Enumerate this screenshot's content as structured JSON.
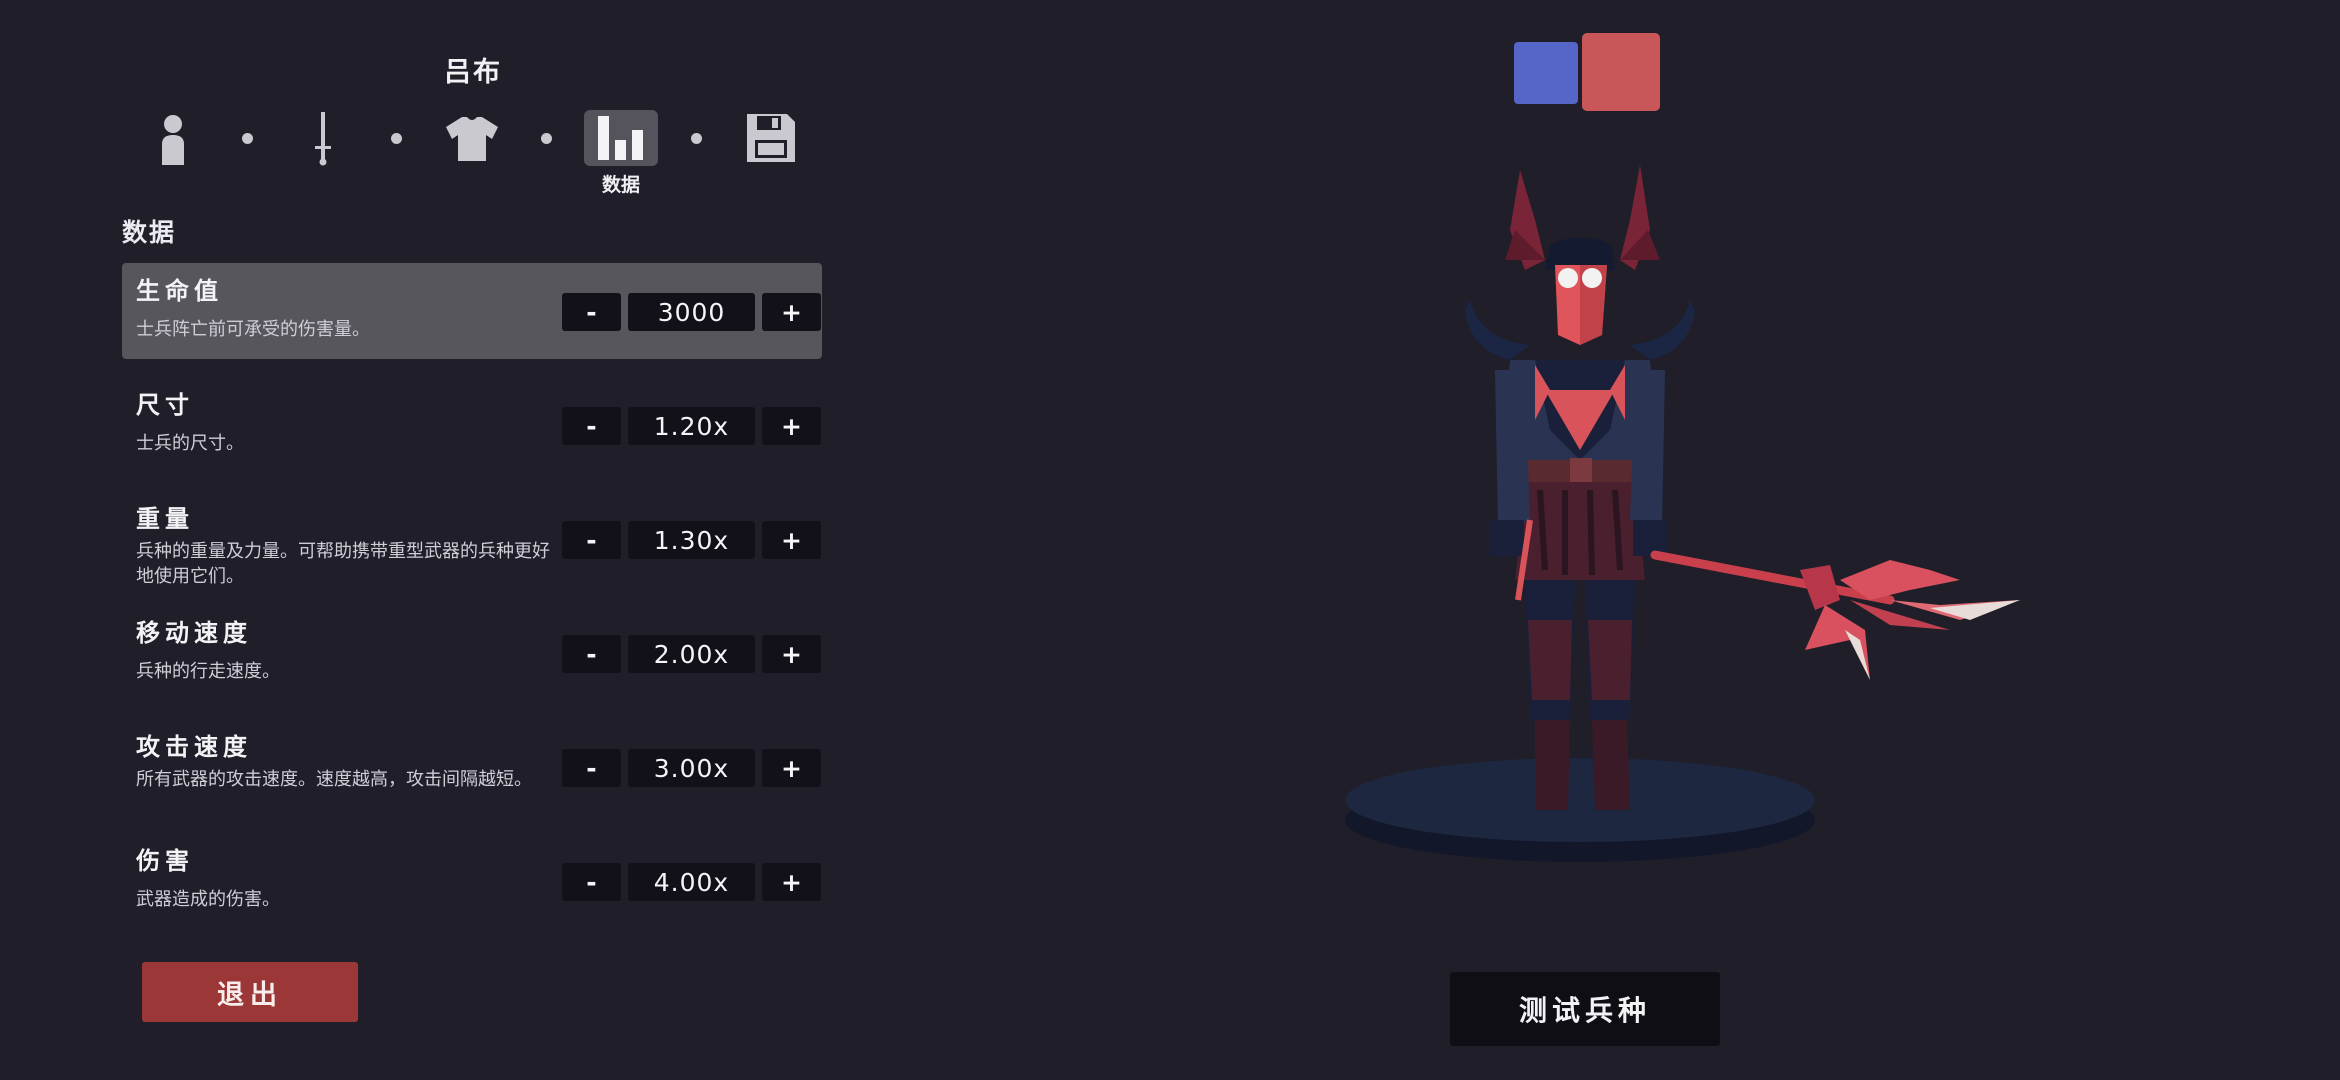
{
  "unit": {
    "name": "吕布"
  },
  "steps": [
    {
      "icon": "body-icon",
      "label": ""
    },
    {
      "icon": "sword-icon",
      "label": ""
    },
    {
      "icon": "shirt-icon",
      "label": ""
    },
    {
      "icon": "stats-icon",
      "label": "数据",
      "active": true
    },
    {
      "icon": "save-icon",
      "label": ""
    }
  ],
  "section": {
    "title": "数据"
  },
  "stats": [
    {
      "name": "生命值",
      "desc": "士兵阵亡前可承受的伤害量。",
      "value": "3000",
      "minus": "-",
      "plus": "+"
    },
    {
      "name": "尺寸",
      "desc": "士兵的尺寸。",
      "value": "1.20x",
      "minus": "-",
      "plus": "+"
    },
    {
      "name": "重量",
      "desc": "兵种的重量及力量。可帮助携带重型武器的兵种更好地使用它们。",
      "value": "1.30x",
      "minus": "-",
      "plus": "+"
    },
    {
      "name": "移动速度",
      "desc": "兵种的行走速度。",
      "value": "2.00x",
      "minus": "-",
      "plus": "+"
    },
    {
      "name": "攻击速度",
      "desc": "所有武器的攻击速度。速度越高，攻击间隔越短。",
      "value": "3.00x",
      "minus": "-",
      "plus": "+"
    },
    {
      "name": "伤害",
      "desc": "武器造成的伤害。",
      "value": "4.00x",
      "minus": "-",
      "plus": "+"
    }
  ],
  "exit_button": {
    "label": "退出"
  },
  "test_button": {
    "label": "测试兵种"
  },
  "colors": {
    "team_blue": "#5565c8",
    "team_red": "#c9575a",
    "exit": "#9c3738",
    "accent_red": "#d9545a"
  }
}
